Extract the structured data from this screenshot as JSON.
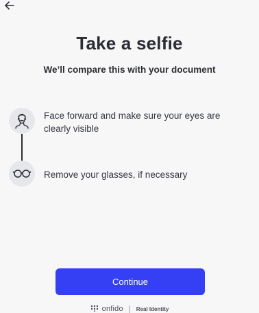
{
  "header": {
    "back_icon": "arrow-left-icon"
  },
  "title": "Take a selfie",
  "subtitle": "We’ll compare this with your document",
  "steps": [
    {
      "icon": "face-icon",
      "text": "Face forward and make sure your eyes are clearly visible"
    },
    {
      "icon": "glasses-icon",
      "text": "Remove your glasses, if necessary"
    }
  ],
  "continue_label": "Continue",
  "footer": {
    "brand": "onfido",
    "tagline": "Real Identity"
  },
  "colors": {
    "primary": "#353ff4",
    "background": "#f7f7f8",
    "icon_bg": "#e6e7ea",
    "text": "#2b2d33"
  }
}
